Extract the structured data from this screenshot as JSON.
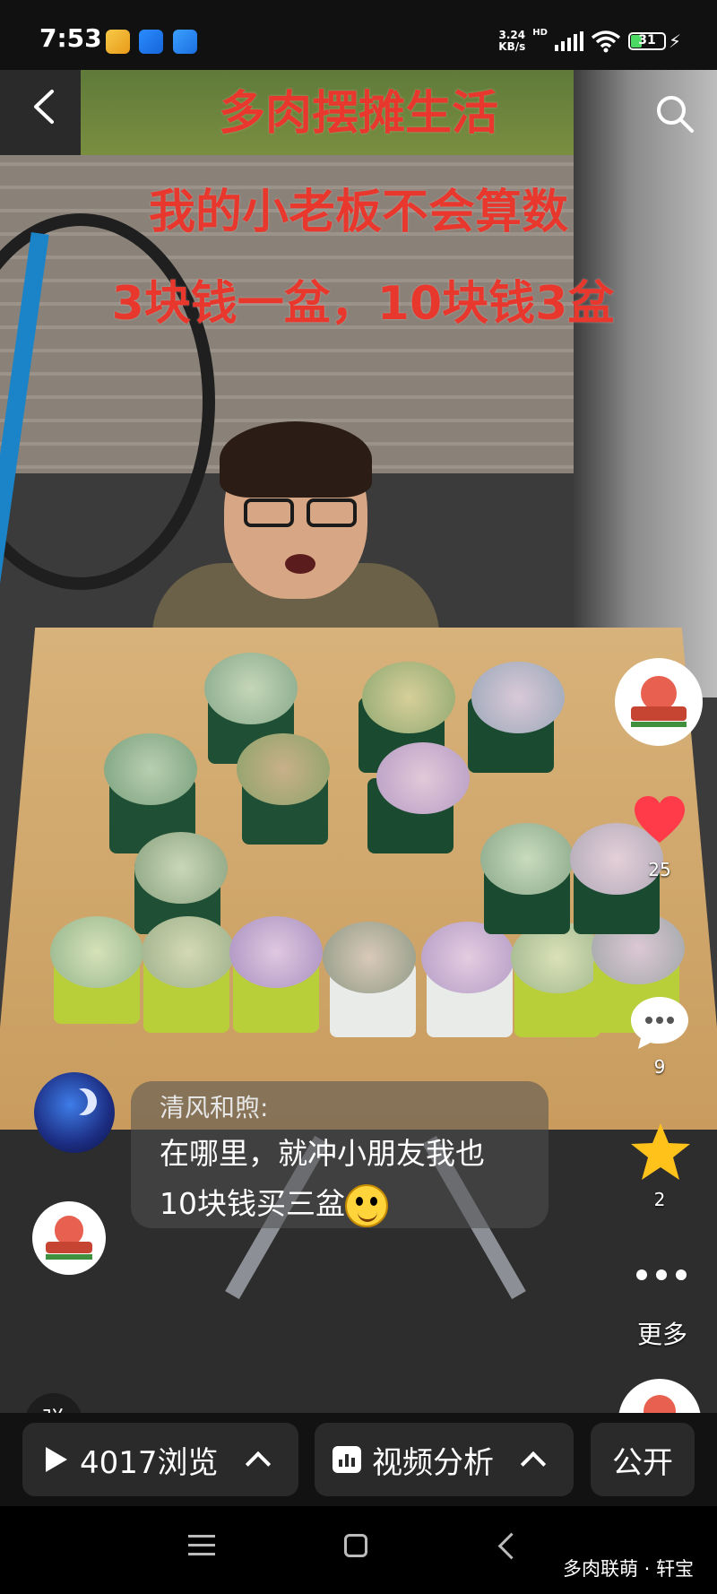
{
  "status_bar": {
    "time": "7:53",
    "network_speed": "3.24",
    "network_unit": "KB/s",
    "network_type": "HD",
    "battery": "31"
  },
  "video": {
    "caption": {
      "line1": "多肉摆摊生活",
      "line2": "我的小老板不会算数",
      "line3": "3块钱一盆，10块钱3盆"
    },
    "likes": "25",
    "comments": "9",
    "favorites": "2",
    "more_label": "更多",
    "danmu_label": "弹",
    "comment": {
      "user": "清风和煦:",
      "line1": "在哪里，就冲小朋友我也",
      "line2": "10块钱买三盆"
    }
  },
  "action_bar": {
    "views_label": "4017浏览",
    "analysis_label": "视频分析",
    "public_label": "公开"
  },
  "watermark": "多肉联萌 · 轩宝",
  "colors": {
    "caption_red": "#e8382e",
    "heart_red": "#ff3b4a",
    "star_gold": "#ffc21a"
  }
}
